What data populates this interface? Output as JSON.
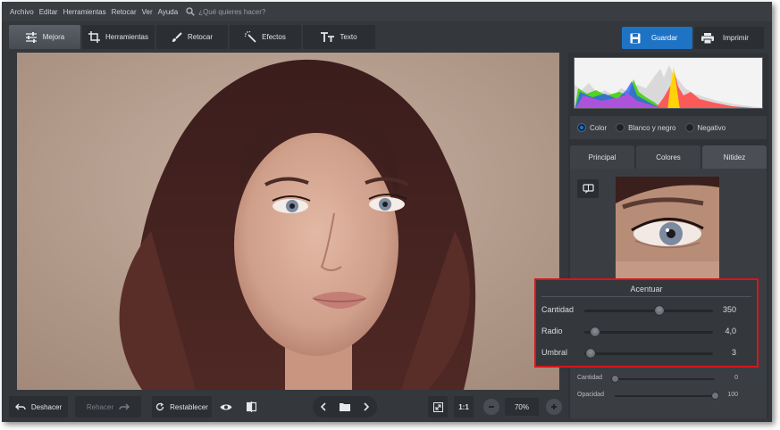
{
  "menubar": {
    "items": [
      "Archivo",
      "Editar",
      "Herramientas",
      "Retocar",
      "Ver",
      "Ayuda"
    ],
    "search_placeholder": "¿Qué quieres hacer?"
  },
  "tabs": [
    {
      "label": "Mejora",
      "icon": "sliders-icon",
      "active": true
    },
    {
      "label": "Herramientas",
      "icon": "crop-icon",
      "active": false
    },
    {
      "label": "Retocar",
      "icon": "brush-icon",
      "active": false
    },
    {
      "label": "Efectos",
      "icon": "magic-wand-icon",
      "active": false
    },
    {
      "label": "Texto",
      "icon": "text-icon",
      "active": false
    }
  ],
  "actions": {
    "save_label": "Guardar",
    "print_label": "Imprimir"
  },
  "color_modes": [
    {
      "label": "Color",
      "selected": true
    },
    {
      "label": "Blanco y negro",
      "selected": false
    },
    {
      "label": "Negativo",
      "selected": false
    }
  ],
  "subtabs": [
    {
      "label": "Principal",
      "active": false
    },
    {
      "label": "Colores",
      "active": false
    },
    {
      "label": "Nitidez",
      "active": true
    }
  ],
  "sharpen": {
    "title": "Acentuar",
    "sliders": [
      {
        "label": "Cantidad",
        "value": "350",
        "level": 0.58
      },
      {
        "label": "Radio",
        "value": "4,0",
        "level": 0.08
      },
      {
        "label": "Umbral",
        "value": "3",
        "level": 0.05
      }
    ]
  },
  "lower_sliders": [
    {
      "label": "Cantidad",
      "value": "0",
      "level": 0.0
    },
    {
      "label": "Opacidad",
      "value": "100",
      "level": 1.0
    }
  ],
  "bottom": {
    "undo_label": "Deshacer",
    "redo_label": "Rehacer",
    "reset_label": "Restablecer",
    "one_to_one": "1:1",
    "zoom": "70%"
  },
  "colors": {
    "accent": "#1e73c5",
    "highlight_box": "#d8161c"
  }
}
